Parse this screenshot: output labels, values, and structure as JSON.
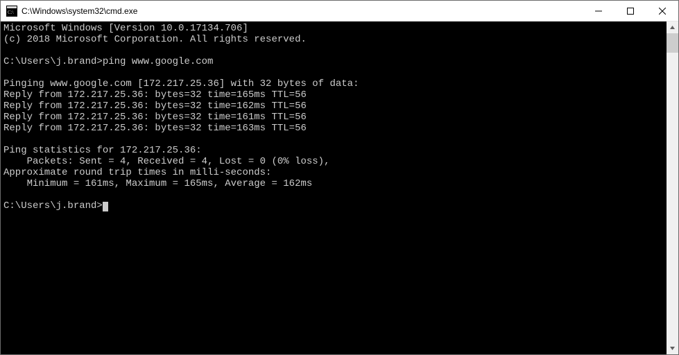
{
  "window": {
    "title": "C:\\Windows\\system32\\cmd.exe"
  },
  "terminal": {
    "header1": "Microsoft Windows [Version 10.0.17134.706]",
    "header2": "(c) 2018 Microsoft Corporation. All rights reserved.",
    "blank": "",
    "prompt1": "C:\\Users\\j.brand>",
    "command1": "ping www.google.com",
    "ping_header": "Pinging www.google.com [172.217.25.36] with 32 bytes of data:",
    "reply1": "Reply from 172.217.25.36: bytes=32 time=165ms TTL=56",
    "reply2": "Reply from 172.217.25.36: bytes=32 time=162ms TTL=56",
    "reply3": "Reply from 172.217.25.36: bytes=32 time=161ms TTL=56",
    "reply4": "Reply from 172.217.25.36: bytes=32 time=163ms TTL=56",
    "stats_header": "Ping statistics for 172.217.25.36:",
    "stats_packets": "    Packets: Sent = 4, Received = 4, Lost = 0 (0% loss),",
    "rtt_header": "Approximate round trip times in milli-seconds:",
    "rtt_values": "    Minimum = 161ms, Maximum = 165ms, Average = 162ms",
    "prompt2": "C:\\Users\\j.brand>"
  }
}
